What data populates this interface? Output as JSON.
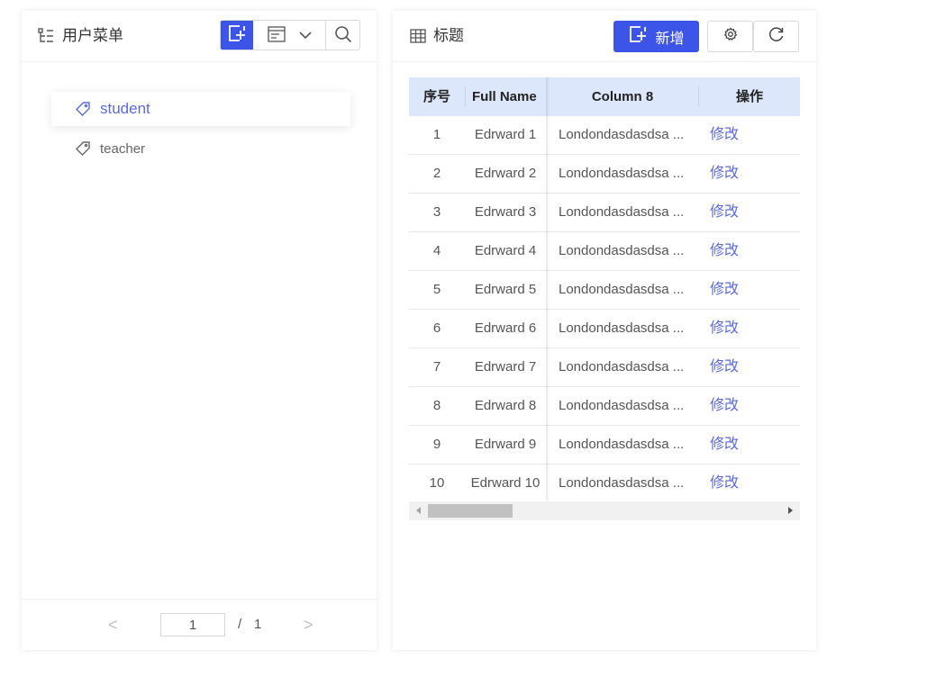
{
  "left_panel": {
    "title": "用户菜单",
    "tree": [
      {
        "label": "student",
        "active": true
      },
      {
        "label": "teacher",
        "active": false
      }
    ],
    "pager": {
      "prev": "<",
      "next": ">",
      "current_page": "1",
      "separator": "/",
      "total_pages": "1"
    }
  },
  "right_panel": {
    "title": "标题",
    "add_label": "新增",
    "table": {
      "columns": [
        "序号",
        "Full Name",
        "Column 8",
        "操作"
      ],
      "rows": [
        {
          "idx": "1",
          "name": "Edrward 1",
          "address": "Londondasdasdsa ...",
          "action": "修改"
        },
        {
          "idx": "2",
          "name": "Edrward 2",
          "address": "Londondasdasdsa ...",
          "action": "修改"
        },
        {
          "idx": "3",
          "name": "Edrward 3",
          "address": "Londondasdasdsa ...",
          "action": "修改"
        },
        {
          "idx": "4",
          "name": "Edrward 4",
          "address": "Londondasdasdsa ...",
          "action": "修改"
        },
        {
          "idx": "5",
          "name": "Edrward 5",
          "address": "Londondasdasdsa ...",
          "action": "修改"
        },
        {
          "idx": "6",
          "name": "Edrward 6",
          "address": "Londondasdasdsa ...",
          "action": "修改"
        },
        {
          "idx": "7",
          "name": "Edrward 7",
          "address": "Londondasdasdsa ...",
          "action": "修改"
        },
        {
          "idx": "8",
          "name": "Edrward 8",
          "address": "Londondasdasdsa ...",
          "action": "修改"
        },
        {
          "idx": "9",
          "name": "Edrward 9",
          "address": "Londondasdasdsa ...",
          "action": "修改"
        },
        {
          "idx": "10",
          "name": "Edrward 10",
          "address": "Londondasdasdsa ...",
          "action": "修改"
        }
      ]
    }
  },
  "colors": {
    "primary": "#3d54e8",
    "link": "#5b6bd6",
    "header_bg": "#dce7fb"
  },
  "icons": {
    "left_title": "tree-icon",
    "add": "add-square-icon",
    "view": "layout-icon",
    "dropdown": "chevron-down-icon",
    "search": "search-icon",
    "tag": "tag-icon",
    "right_title": "table-icon",
    "settings": "gear-icon",
    "refresh": "refresh-icon"
  }
}
